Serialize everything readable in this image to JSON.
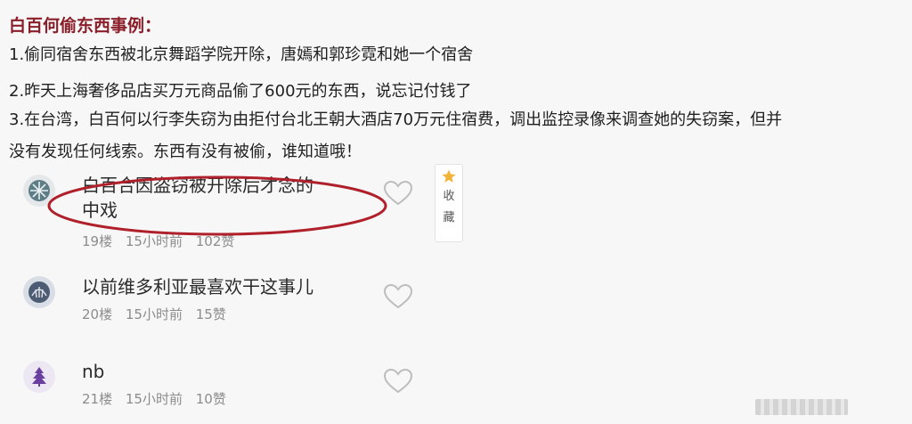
{
  "article": {
    "title": "白百何偷东西事例：",
    "lines": [
      "1.偷同宿舍东西被北京舞蹈学院开除，唐嫣和郭珍霓和她一个宿舍",
      "2.昨天上海奢侈品店买万元商品偷了600元的东西，说忘记付钱了",
      "3.在台湾，白百何以行李失窃为由拒付台北王朝大酒店70万元住宿费，调出监控录像来调查她的失窃案，但并",
      "没有发现任何线索。东西有没有被偷，谁知道哦！"
    ]
  },
  "comments": [
    {
      "text_line1": "白百合因盗窃被开除后才念的",
      "text_line2": "中戏",
      "floor": "19楼",
      "time": "15小时前",
      "likes": "102赞",
      "avatar_icon": "snowflake-avatar-icon"
    },
    {
      "text_line1": "以前维多利亚最喜欢干这事儿",
      "floor": "20楼",
      "time": "15小时前",
      "likes": "15赞",
      "avatar_icon": "shell-avatar-icon"
    },
    {
      "text_line1": "nb",
      "floor": "21楼",
      "time": "15小时前",
      "likes": "10赞",
      "avatar_icon": "tree-avatar-icon"
    }
  ],
  "favorite": {
    "label_1": "收",
    "label_2": "藏",
    "icon": "star-icon"
  },
  "colors": {
    "title": "#8a1f2a",
    "annotation_oval": "#b0202a",
    "star": "#f2b33a",
    "meta": "#8c8c8c"
  }
}
